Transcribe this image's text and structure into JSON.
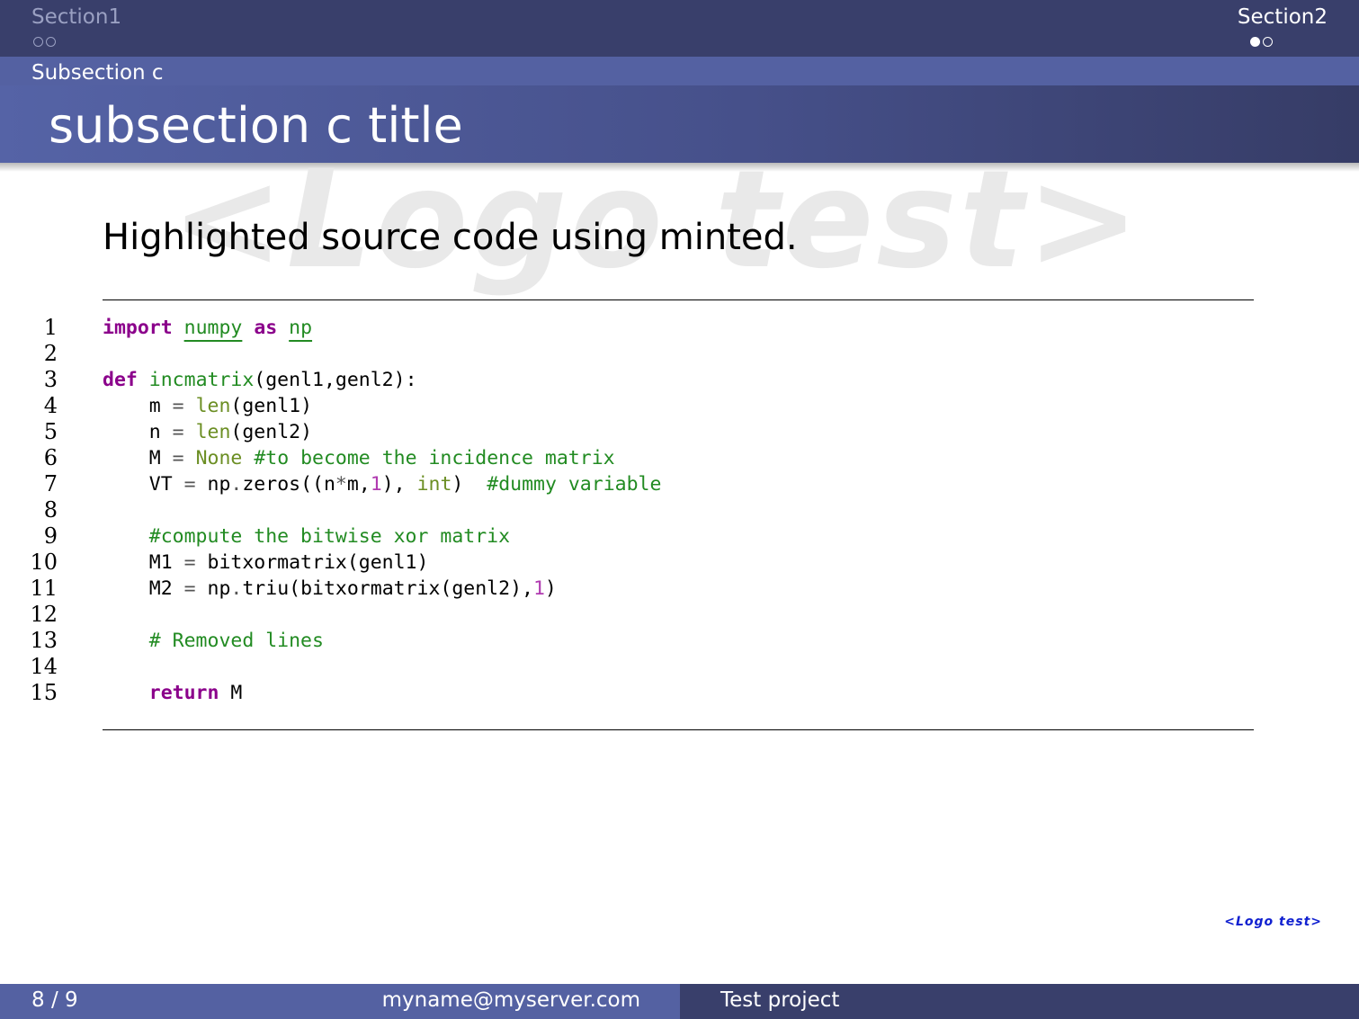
{
  "header": {
    "section1": "Section1",
    "section2": "Section2",
    "subsection": "Subsection c",
    "title": "subsection c title"
  },
  "watermark": "<Logo test>",
  "body": {
    "heading": "Highlighted source code using minted."
  },
  "code_lines": [
    {
      "no": "1",
      "tokens": [
        [
          "kw",
          "import"
        ],
        [
          "pu",
          " "
        ],
        [
          "mod",
          "numpy"
        ],
        [
          "pu",
          " "
        ],
        [
          "kw",
          "as"
        ],
        [
          "pu",
          " "
        ],
        [
          "mod",
          "np"
        ]
      ]
    },
    {
      "no": "2",
      "tokens": []
    },
    {
      "no": "3",
      "tokens": [
        [
          "kw",
          "def"
        ],
        [
          "pu",
          " "
        ],
        [
          "fn",
          "incmatrix"
        ],
        [
          "pu",
          "(genl1,genl2):"
        ]
      ]
    },
    {
      "no": "4",
      "tokens": [
        [
          "pu",
          "    m "
        ],
        [
          "op",
          "="
        ],
        [
          "pu",
          " "
        ],
        [
          "bi",
          "len"
        ],
        [
          "pu",
          "(genl1)"
        ]
      ]
    },
    {
      "no": "5",
      "tokens": [
        [
          "pu",
          "    n "
        ],
        [
          "op",
          "="
        ],
        [
          "pu",
          " "
        ],
        [
          "bi",
          "len"
        ],
        [
          "pu",
          "(genl2)"
        ]
      ]
    },
    {
      "no": "6",
      "tokens": [
        [
          "pu",
          "    M "
        ],
        [
          "op",
          "="
        ],
        [
          "pu",
          " "
        ],
        [
          "bi",
          "None"
        ],
        [
          "pu",
          " "
        ],
        [
          "cm",
          "#to become the incidence matrix"
        ]
      ]
    },
    {
      "no": "7",
      "tokens": [
        [
          "pu",
          "    VT "
        ],
        [
          "op",
          "="
        ],
        [
          "pu",
          " np"
        ],
        [
          "op",
          "."
        ],
        [
          "pu",
          "zeros((n"
        ],
        [
          "op",
          "*"
        ],
        [
          "pu",
          "m,"
        ],
        [
          "nm",
          "1"
        ],
        [
          "pu",
          "), "
        ],
        [
          "bi",
          "int"
        ],
        [
          "pu",
          ")  "
        ],
        [
          "cm",
          "#dummy variable"
        ]
      ]
    },
    {
      "no": "8",
      "tokens": []
    },
    {
      "no": "9",
      "tokens": [
        [
          "pu",
          "    "
        ],
        [
          "cm",
          "#compute the bitwise xor matrix"
        ]
      ]
    },
    {
      "no": "10",
      "tokens": [
        [
          "pu",
          "    M1 "
        ],
        [
          "op",
          "="
        ],
        [
          "pu",
          " bitxormatrix(genl1)"
        ]
      ]
    },
    {
      "no": "11",
      "tokens": [
        [
          "pu",
          "    M2 "
        ],
        [
          "op",
          "="
        ],
        [
          "pu",
          " np"
        ],
        [
          "op",
          "."
        ],
        [
          "pu",
          "triu(bitxormatrix(genl2),"
        ],
        [
          "nm",
          "1"
        ],
        [
          "pu",
          ")"
        ]
      ]
    },
    {
      "no": "12",
      "tokens": []
    },
    {
      "no": "13",
      "tokens": [
        [
          "pu",
          "    "
        ],
        [
          "cm",
          "# Removed lines"
        ]
      ]
    },
    {
      "no": "14",
      "tokens": []
    },
    {
      "no": "15",
      "tokens": [
        [
          "pu",
          "    "
        ],
        [
          "kw",
          "return"
        ],
        [
          "pu",
          " M"
        ]
      ]
    }
  ],
  "logo_small": "<Logo test>",
  "footer": {
    "page": "8 / 9",
    "email": "myname@myserver.com",
    "project": "Test project"
  },
  "colors": {
    "nav_bg": "#393f6b",
    "subsection_bg": "#5461a2",
    "keyword": "#8b008b",
    "function": "#228b22",
    "builtin": "#6b8e23",
    "comment": "#228b22",
    "number": "#b03ab0"
  }
}
